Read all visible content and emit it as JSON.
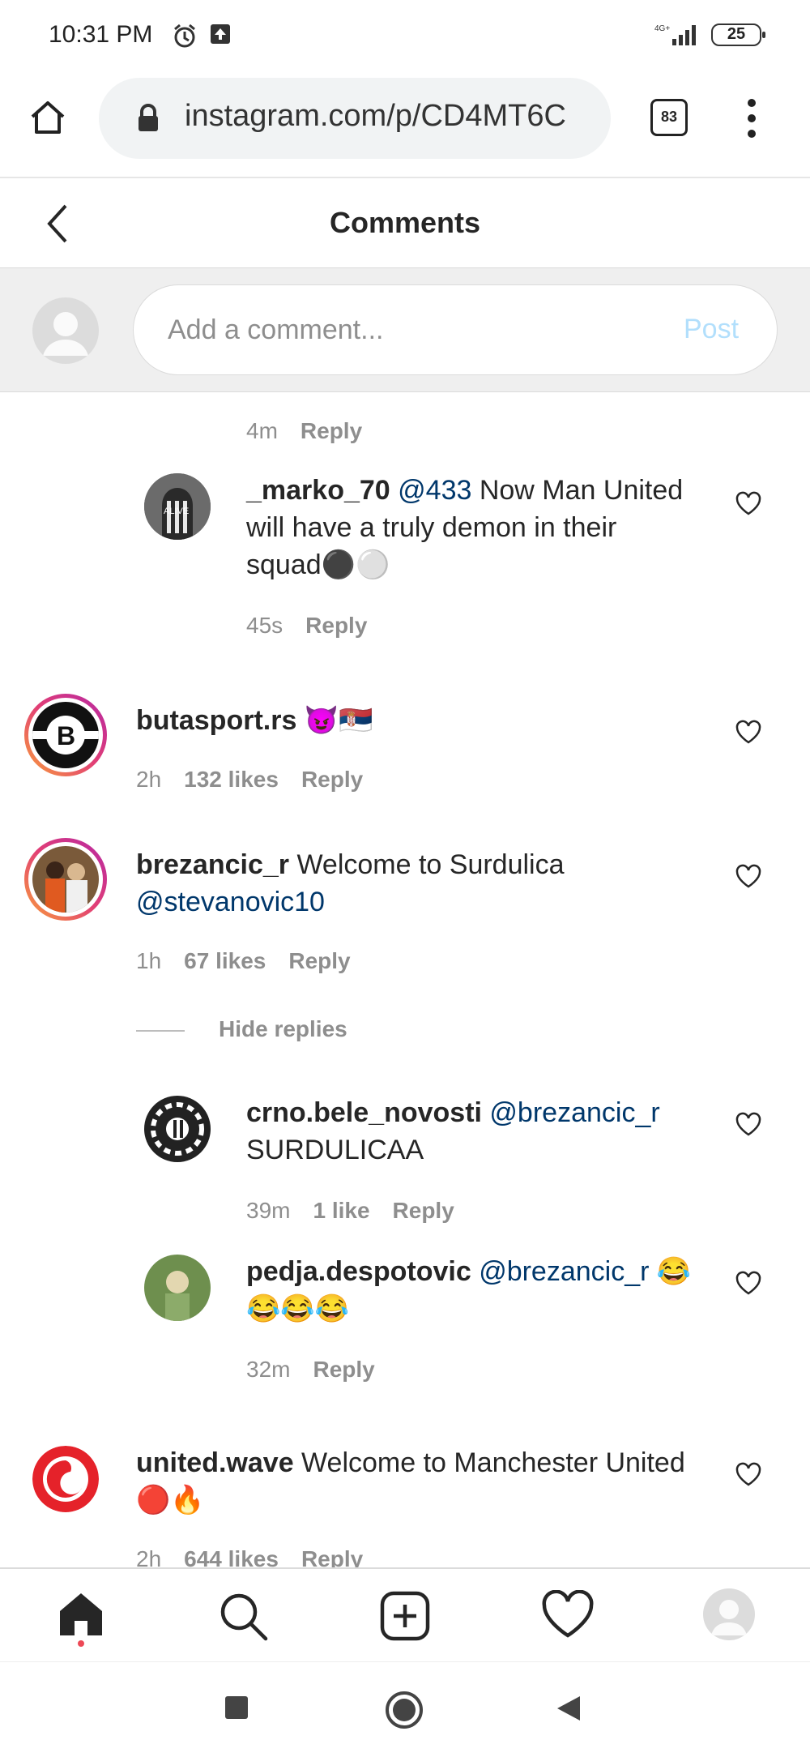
{
  "status_bar": {
    "time": "10:31 PM",
    "battery": "25",
    "network": "4G+"
  },
  "browser": {
    "url": "instagram.com/p/CD4MT6C",
    "tabs_count": "83"
  },
  "header": {
    "title": "Comments"
  },
  "composer": {
    "placeholder": "Add a comment...",
    "post_label": "Post"
  },
  "comments": [
    {
      "time": "4m",
      "reply_label": "Reply"
    },
    {
      "username": "_marko_70",
      "mention": "@433",
      "text": " Now Man United will have a truly demon in their squad",
      "emoji": "⚫⚪",
      "time": "45s",
      "reply_label": "Reply"
    },
    {
      "username": "butasport.rs",
      "text": " ",
      "emoji": "😈🇷🇸",
      "time": "2h",
      "likes": "132 likes",
      "reply_label": "Reply"
    },
    {
      "username": "brezancic_r",
      "text": " Welcome to Surdulica ",
      "mention": "@stevanovic10",
      "time": "1h",
      "likes": "67 likes",
      "reply_label": "Reply",
      "hide_replies": "Hide replies"
    },
    {
      "username": "crno.bele_novosti",
      "mention": "@brezancic_r",
      "text": " SURDULICAA",
      "time": "39m",
      "likes": "1 like",
      "reply_label": "Reply"
    },
    {
      "username": "pedja.despotovic",
      "mention": "@brezancic_r",
      "emoji": " 😂 😂😂😂",
      "time": "32m",
      "reply_label": "Reply"
    },
    {
      "username": "united.wave",
      "text": " Welcome to Manchester United ",
      "emoji": "🔴🔥",
      "time": "2h",
      "likes": "644 likes",
      "reply_label": "Reply"
    }
  ],
  "colors": {
    "mention": "#00376b",
    "post_disabled": "#b2dffc",
    "meta": "#8e8e8e"
  }
}
